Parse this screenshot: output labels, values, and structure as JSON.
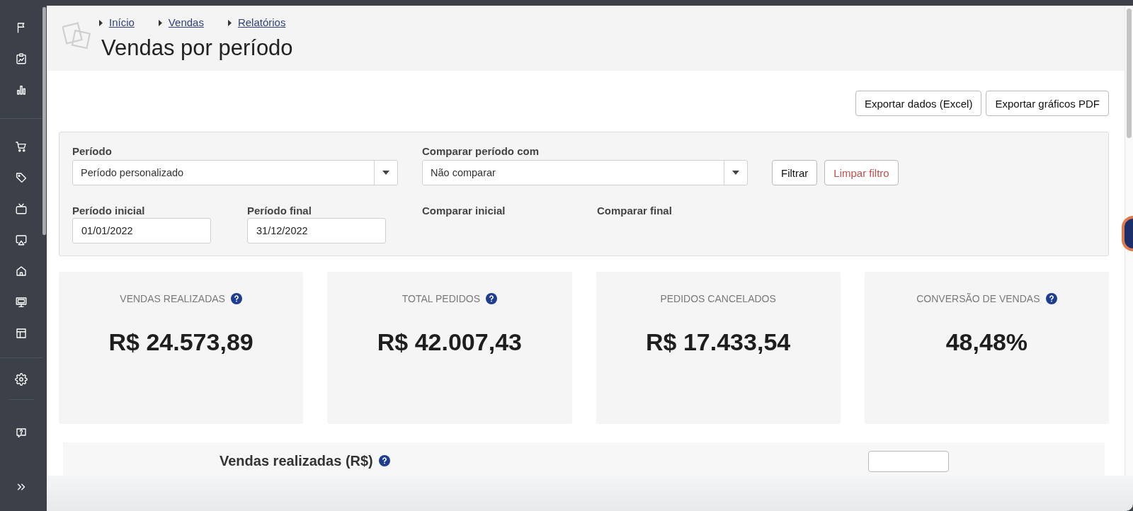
{
  "breadcrumbs": [
    "Início",
    "Vendas",
    "Relatórios"
  ],
  "page_title": "Vendas por período",
  "export_buttons": [
    "Exportar dados (Excel)",
    "Exportar gráficos PDF"
  ],
  "filters": {
    "selects": [
      {
        "label": "Período",
        "value": "Período personalizado"
      },
      {
        "label": "Comparar período com",
        "value": "Não comparar"
      }
    ],
    "buttons": [
      {
        "label": "Filtrar",
        "kind": "default"
      },
      {
        "label": "Limpar filtro",
        "kind": "danger"
      }
    ],
    "dates": [
      {
        "label": "Período inicial",
        "value": "01/01/2022"
      },
      {
        "label": "Período final",
        "value": "31/12/2022"
      },
      {
        "label": "Comparar inicial"
      },
      {
        "label": "Comparar final"
      }
    ]
  },
  "stats": [
    {
      "label": "VENDAS REALIZADAS",
      "value": "R$ 24.573,89",
      "help": true
    },
    {
      "label": "TOTAL PEDIDOS",
      "value": "R$ 42.007,43",
      "help": true
    },
    {
      "label": "PEDIDOS CANCELADOS",
      "value": "R$ 17.433,54",
      "help": false
    },
    {
      "label": "CONVERSÃO DE VENDAS",
      "value": "48,48%",
      "help": true
    }
  ],
  "chart_section": {
    "title": "Vendas realizadas (R$)",
    "help": true
  }
}
